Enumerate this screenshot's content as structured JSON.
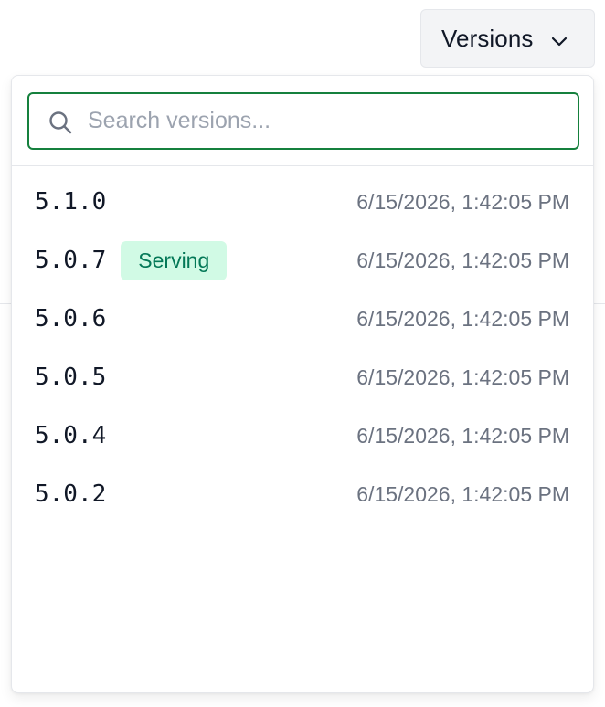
{
  "header": {
    "versions_button_label": "Versions",
    "chevron_icon": "chevron-down-icon"
  },
  "dropdown": {
    "search": {
      "placeholder": "Search versions...",
      "value": "",
      "icon": "search-icon"
    },
    "versions": [
      {
        "version": "5.1.0",
        "badge": "",
        "timestamp": "6/15/2026, 1:42:05 PM"
      },
      {
        "version": "5.0.7",
        "badge": "Serving",
        "timestamp": "6/15/2026, 1:42:05 PM"
      },
      {
        "version": "5.0.6",
        "badge": "",
        "timestamp": "6/15/2026, 1:42:05 PM"
      },
      {
        "version": "5.0.5",
        "badge": "",
        "timestamp": "6/15/2026, 1:42:05 PM"
      },
      {
        "version": "5.0.4",
        "badge": "",
        "timestamp": "6/15/2026, 1:42:05 PM"
      },
      {
        "version": "5.0.2",
        "badge": "",
        "timestamp": "6/15/2026, 1:42:05 PM"
      }
    ]
  },
  "colors": {
    "accent_green": "#15803d",
    "badge_bg": "#d1fae5",
    "badge_text": "#047857",
    "muted_text": "#6b7280"
  }
}
